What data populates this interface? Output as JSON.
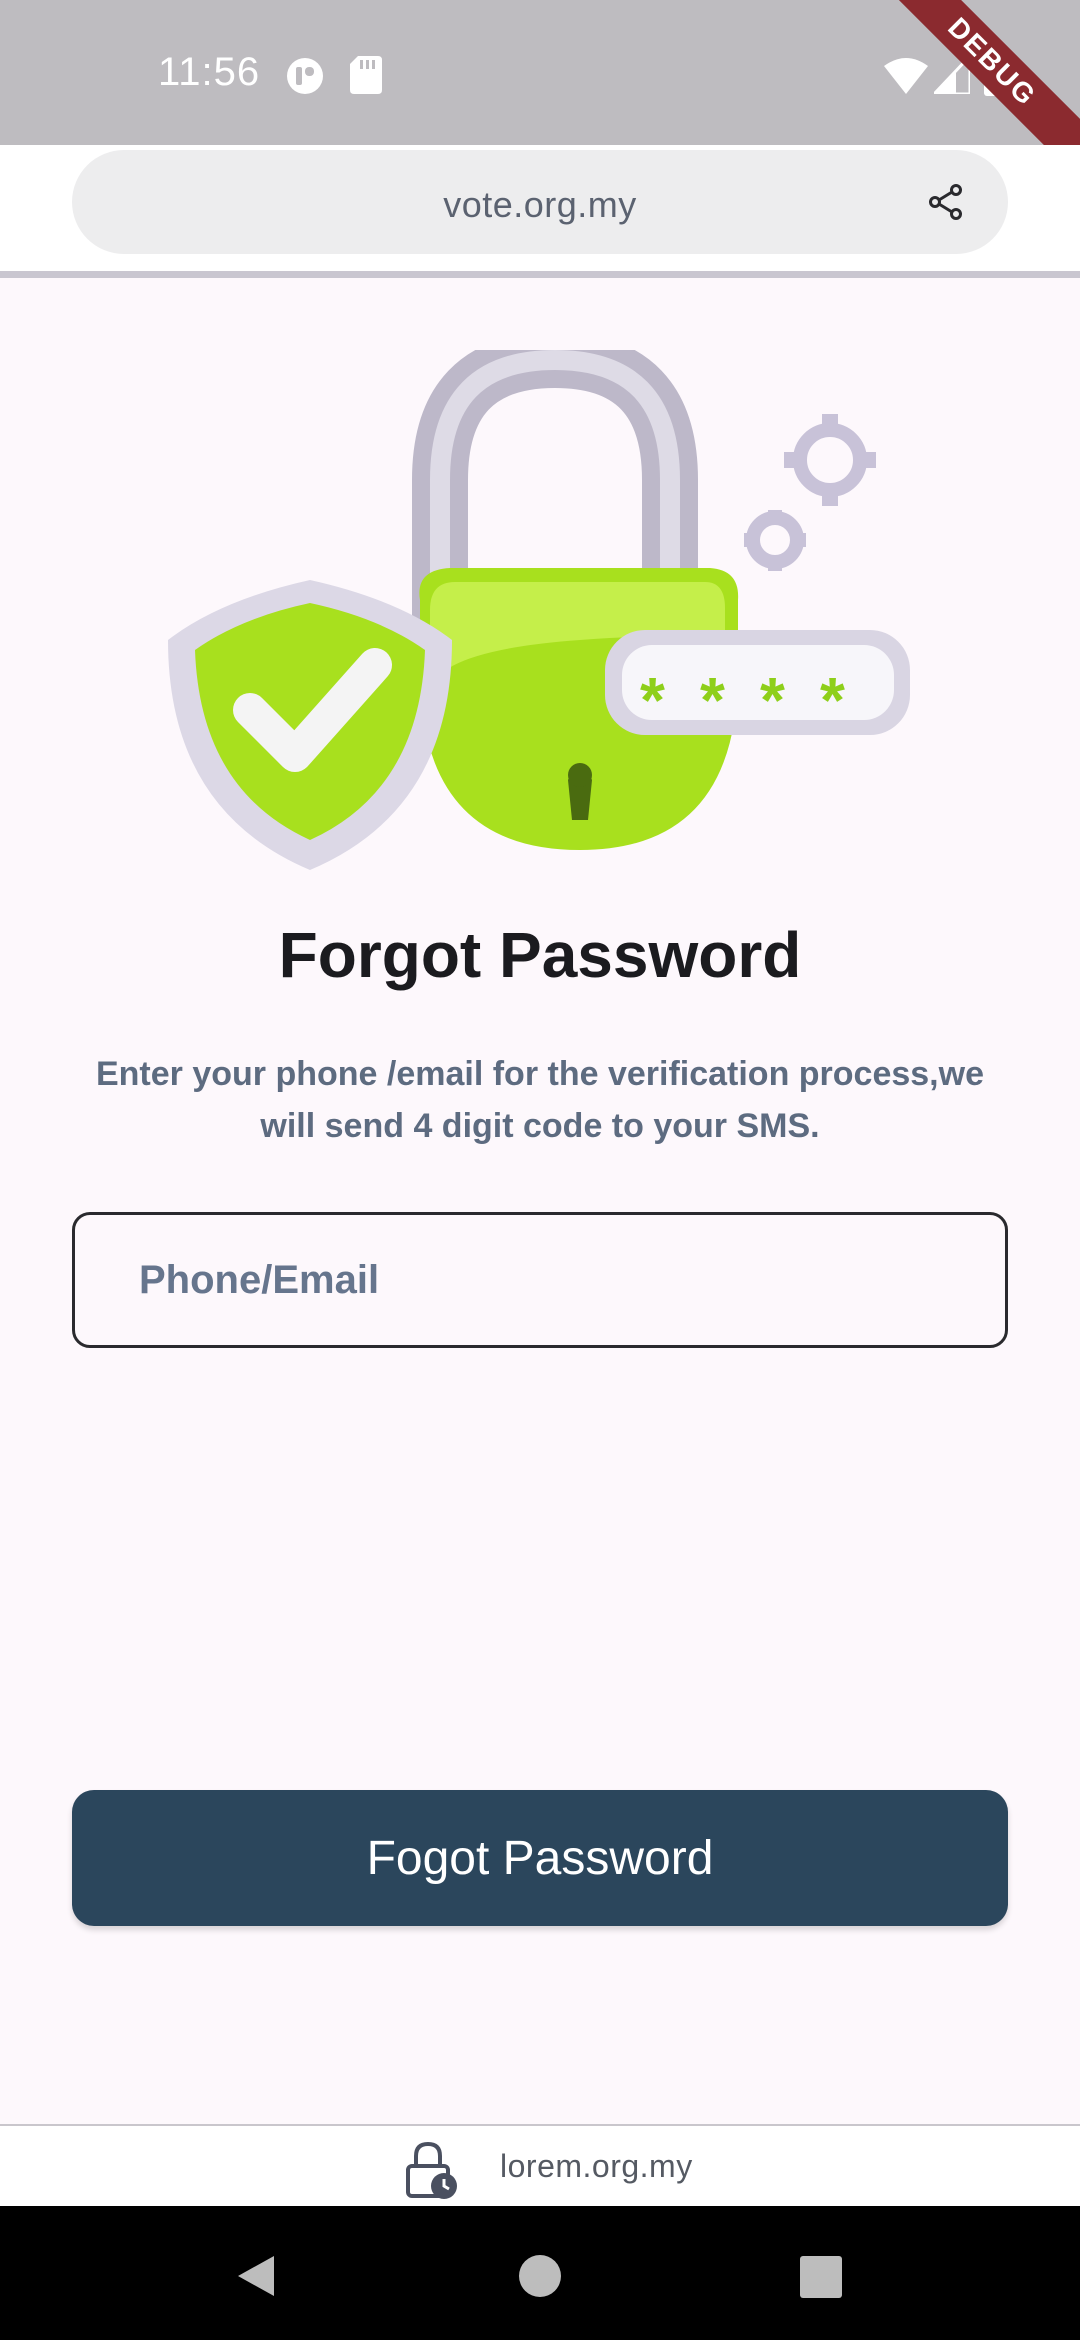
{
  "status_bar": {
    "time": "11:56",
    "debug_label": "DEBUG",
    "icons": [
      "media-icon",
      "sd-card-icon",
      "wifi-icon",
      "signal-icon",
      "battery-icon"
    ]
  },
  "browser": {
    "url": "vote.org.my",
    "share_icon": "share-icon"
  },
  "illustration": {
    "icon": "padlock-shield-illustration",
    "masked_code": "****"
  },
  "main": {
    "title": "Forgot Password",
    "subtitle": "Enter your phone /email for the verification process,we will send 4 digit code to your SMS.",
    "input_placeholder": "Phone/Email",
    "input_value": "",
    "submit_label": "Fogot Password"
  },
  "footer": {
    "text": "lorem.org.my",
    "icon": "lock-clock-icon"
  },
  "nav_bar": {
    "icons": [
      "back-icon",
      "home-icon",
      "recents-icon"
    ]
  },
  "colors": {
    "primary": "#2b465c",
    "accent_green": "#a8e01e",
    "background": "#fdf8fc",
    "subtitle": "#5d6b80"
  }
}
